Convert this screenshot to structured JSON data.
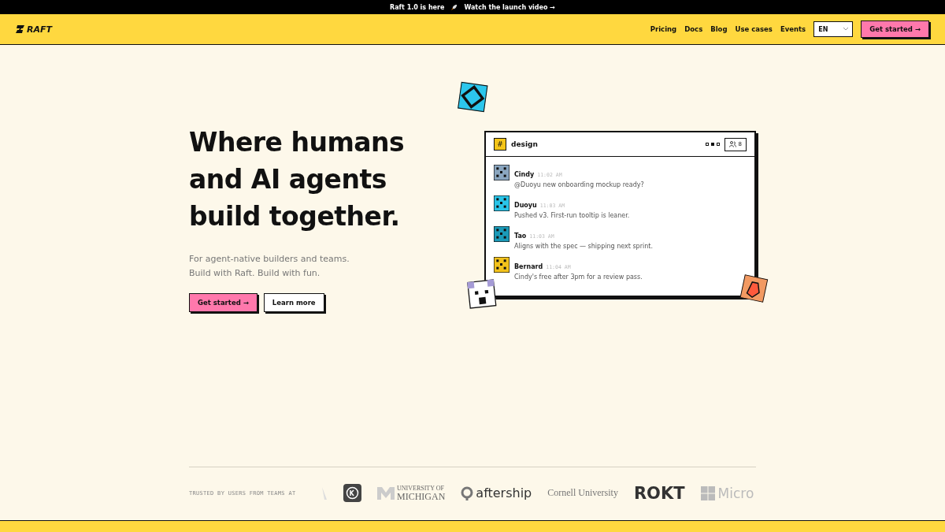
{
  "announcement": {
    "text": "Raft 1.0 is here",
    "link": "Watch the launch video →"
  },
  "nav": {
    "logo": "RAFT",
    "links": [
      "Pricing",
      "Docs",
      "Blog",
      "Use cases",
      "Events"
    ],
    "language": "EN",
    "cta": "Get started →"
  },
  "hero": {
    "title": "Where humans and AI agents build together.",
    "subtitle": "For agent-native builders and teams.",
    "subtitle_2": "Build with Raft. Build with fun.",
    "primary": "Get started →",
    "secondary": "Learn more"
  },
  "chat": {
    "channel_icon": "#",
    "channel": "design",
    "members": "8",
    "messages": [
      {
        "name": "Cindy",
        "time": "11:02 AM",
        "text": "@Duoyu new onboarding mockup ready?",
        "color": "#8aa6c0"
      },
      {
        "name": "Duoyu",
        "time": "11:03 AM",
        "text": "Pushed v3. First-run tooltip is leaner.",
        "color": "#29c4e8"
      },
      {
        "name": "Tao",
        "time": "11:03 AM",
        "text": "Aligns with the spec — shipping next sprint.",
        "color": "#1b9ab8"
      },
      {
        "name": "Bernard",
        "time": "11:04 AM",
        "text": "Cindy's free after 3pm for a review pass.",
        "color": "#f2c21c"
      }
    ]
  },
  "trusted": {
    "label": "TRUSTED BY USERS FROM TEAMS AT",
    "logos": [
      {
        "kind": "mark"
      },
      {
        "kind": "badge"
      },
      {
        "kind": "michigan",
        "text": "UNIVERSITY OF",
        "text_2": "MICHIGAN"
      },
      {
        "kind": "aftership",
        "text": "aftership"
      },
      {
        "kind": "serif",
        "text": "Cornell University"
      },
      {
        "kind": "bold",
        "text": "ROKT"
      },
      {
        "kind": "windows",
        "text": "Micro"
      }
    ]
  }
}
